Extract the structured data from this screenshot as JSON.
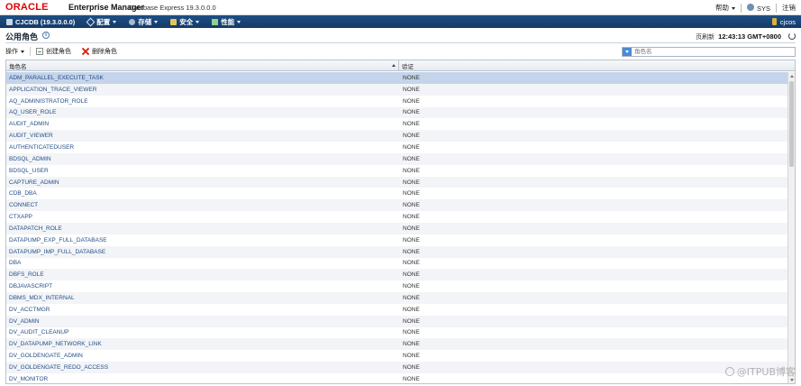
{
  "brand": {
    "logo_text": "ORACLE",
    "product": "Enterprise Manager",
    "subtitle": "Database Express 19.3.0.0.0"
  },
  "top_right": {
    "help_label": "帮助",
    "user_label": "SYS",
    "logout_label": "注销"
  },
  "nav": {
    "db_label": "CJCDB (19.3.0.0.0)",
    "items": [
      {
        "label": "配置"
      },
      {
        "label": "存储"
      },
      {
        "label": "安全"
      },
      {
        "label": "性能"
      }
    ],
    "container_label": "cjcos"
  },
  "page": {
    "title": "公用角色",
    "refreshed_label": "页刷新",
    "refreshed_time": "12:43:13 GMT+0800"
  },
  "toolbar": {
    "actions_label": "操作",
    "create_label": "创建角色",
    "delete_label": "删除角色",
    "search_placeholder": "角色名"
  },
  "table": {
    "columns": [
      "角色名",
      "验证"
    ],
    "rows": [
      {
        "name": "ADM_PARALLEL_EXECUTE_TASK",
        "auth": "NONE"
      },
      {
        "name": "APPLICATION_TRACE_VIEWER",
        "auth": "NONE"
      },
      {
        "name": "AQ_ADMINISTRATOR_ROLE",
        "auth": "NONE"
      },
      {
        "name": "AQ_USER_ROLE",
        "auth": "NONE"
      },
      {
        "name": "AUDIT_ADMIN",
        "auth": "NONE"
      },
      {
        "name": "AUDIT_VIEWER",
        "auth": "NONE"
      },
      {
        "name": "AUTHENTICATEDUSER",
        "auth": "NONE"
      },
      {
        "name": "BDSQL_ADMIN",
        "auth": "NONE"
      },
      {
        "name": "BDSQL_USER",
        "auth": "NONE"
      },
      {
        "name": "CAPTURE_ADMIN",
        "auth": "NONE"
      },
      {
        "name": "CDB_DBA",
        "auth": "NONE"
      },
      {
        "name": "CONNECT",
        "auth": "NONE"
      },
      {
        "name": "CTXAPP",
        "auth": "NONE"
      },
      {
        "name": "DATAPATCH_ROLE",
        "auth": "NONE"
      },
      {
        "name": "DATAPUMP_EXP_FULL_DATABASE",
        "auth": "NONE"
      },
      {
        "name": "DATAPUMP_IMP_FULL_DATABASE",
        "auth": "NONE"
      },
      {
        "name": "DBA",
        "auth": "NONE"
      },
      {
        "name": "DBFS_ROLE",
        "auth": "NONE"
      },
      {
        "name": "DBJAVASCRIPT",
        "auth": "NONE"
      },
      {
        "name": "DBMS_MDX_INTERNAL",
        "auth": "NONE"
      },
      {
        "name": "DV_ACCTMGR",
        "auth": "NONE"
      },
      {
        "name": "DV_ADMIN",
        "auth": "NONE"
      },
      {
        "name": "DV_AUDIT_CLEANUP",
        "auth": "NONE"
      },
      {
        "name": "DV_DATAPUMP_NETWORK_LINK",
        "auth": "NONE"
      },
      {
        "name": "DV_GOLDENGATE_ADMIN",
        "auth": "NONE"
      },
      {
        "name": "DV_GOLDENGATE_REDO_ACCESS",
        "auth": "NONE"
      },
      {
        "name": "DV_MONITOR",
        "auth": "NONE"
      }
    ]
  },
  "watermark": "@ITPUB博客",
  "colors": {
    "nav_bg": "#1f4f86",
    "brand_red": "#e00000",
    "link": "#254e87",
    "selected_row": "#c4d4ea"
  }
}
